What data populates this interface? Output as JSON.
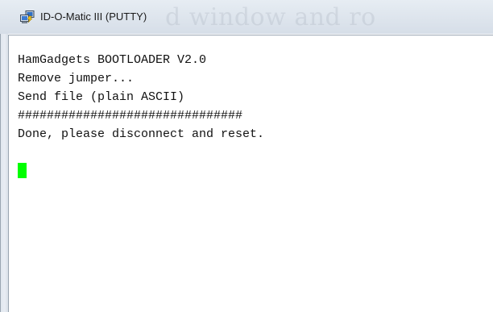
{
  "window": {
    "title": "ID-O-Matic III (PUTTY)",
    "icon": "putty-icon",
    "background_title_fragment": "d window and ro"
  },
  "terminal": {
    "lines": [
      "HamGadgets BOOTLOADER V2.0",
      "Remove jumper...",
      "Send file (plain ASCII)",
      "###############################",
      "Done, please disconnect and reset."
    ],
    "cursor_color": "#00ff00",
    "background_color": "#ffffff",
    "text_color": "#111111"
  }
}
